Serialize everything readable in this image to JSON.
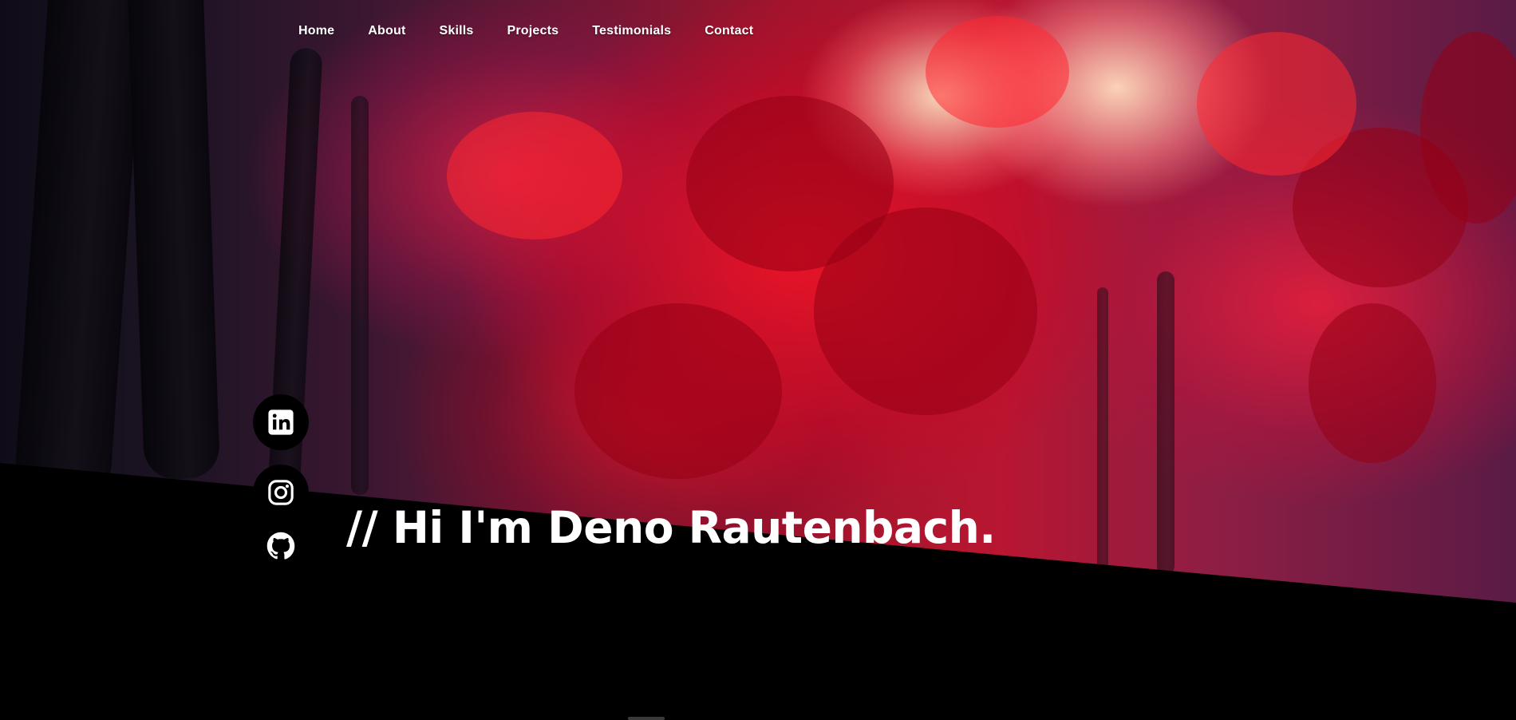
{
  "nav": {
    "items": [
      {
        "label": "Home"
      },
      {
        "label": "About"
      },
      {
        "label": "Skills"
      },
      {
        "label": "Projects"
      },
      {
        "label": "Testimonials"
      },
      {
        "label": "Contact"
      }
    ]
  },
  "hero": {
    "headline": "// Hi I'm Deno Rautenbach.",
    "background_description_colors": {
      "accent_red": "#d3122b",
      "deep_purple": "#2a1a33",
      "band": "#000000"
    }
  },
  "social": {
    "items": [
      {
        "icon": "linkedin-icon"
      },
      {
        "icon": "instagram-icon"
      },
      {
        "icon": "github-icon"
      }
    ]
  }
}
